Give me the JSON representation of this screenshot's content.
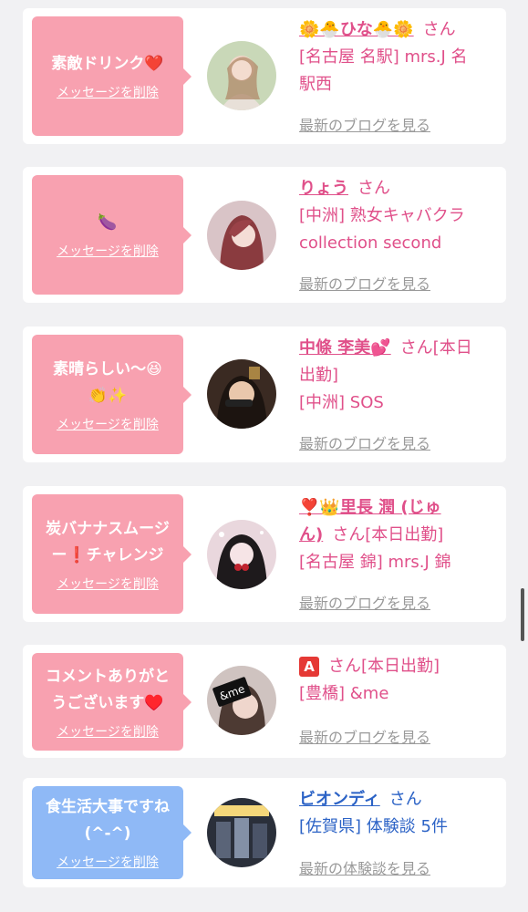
{
  "cards": [
    {
      "message": "素敵ドリンク❤️",
      "delete_label": "メッセージを削除",
      "name": "🌼🐣ひな🐣🌼",
      "san": "さん",
      "store_line1": "[名古屋 名駅] mrs.J 名",
      "store_line2": "駅西",
      "link": "最新のブログを見る",
      "bubble_color": "#f8a1b0"
    },
    {
      "message": "🍆",
      "delete_label": "メッセージを削除",
      "name": "りょう",
      "san": "さん",
      "store_line1": "[中洲] 熟女キャバクラ",
      "store_line2": "collection second",
      "link": "最新のブログを見る",
      "bubble_color": "#f8a1b0"
    },
    {
      "message": "素晴らしい〜😆\n👏✨",
      "delete_label": "メッセージを削除",
      "name": "中條 李美💕",
      "san": "さん[本日",
      "name_line2": "出勤]",
      "store_line1": "[中洲] SOS",
      "link": "最新のブログを見る",
      "bubble_color": "#f8a1b0"
    },
    {
      "message": "炭バナナスムージ\nー❗️チャレンジ",
      "delete_label": "メッセージを削除",
      "name": "❣️👑里長 潤 (じゅ",
      "name_line2": "ん)",
      "san": "さん[本日出勤]",
      "store_line1": "[名古屋 錦] mrs.J 錦",
      "link": "最新のブログを見る",
      "bubble_color": "#f8a1b0"
    },
    {
      "message": "コメントありがと\nうございます♥️",
      "delete_label": "メッセージを削除",
      "name": "A",
      "san": "さん[本日出勤]",
      "store_line1": "[豊橋] &me",
      "avatar_text": "&me",
      "link": "最新のブログを見る",
      "bubble_color": "#f8a1b0"
    },
    {
      "message": "食生活大事ですね\n(^-^)",
      "delete_label": "メッセージを削除",
      "name": "ビオンディ",
      "san": "さん",
      "store_line1": "[佐賀県] 体験談 5件",
      "link": "最新の体験談を見る",
      "bubble_color": "#8fb9f6"
    }
  ],
  "accent_pink": "#e0508a",
  "accent_blue": "#2c63c6"
}
